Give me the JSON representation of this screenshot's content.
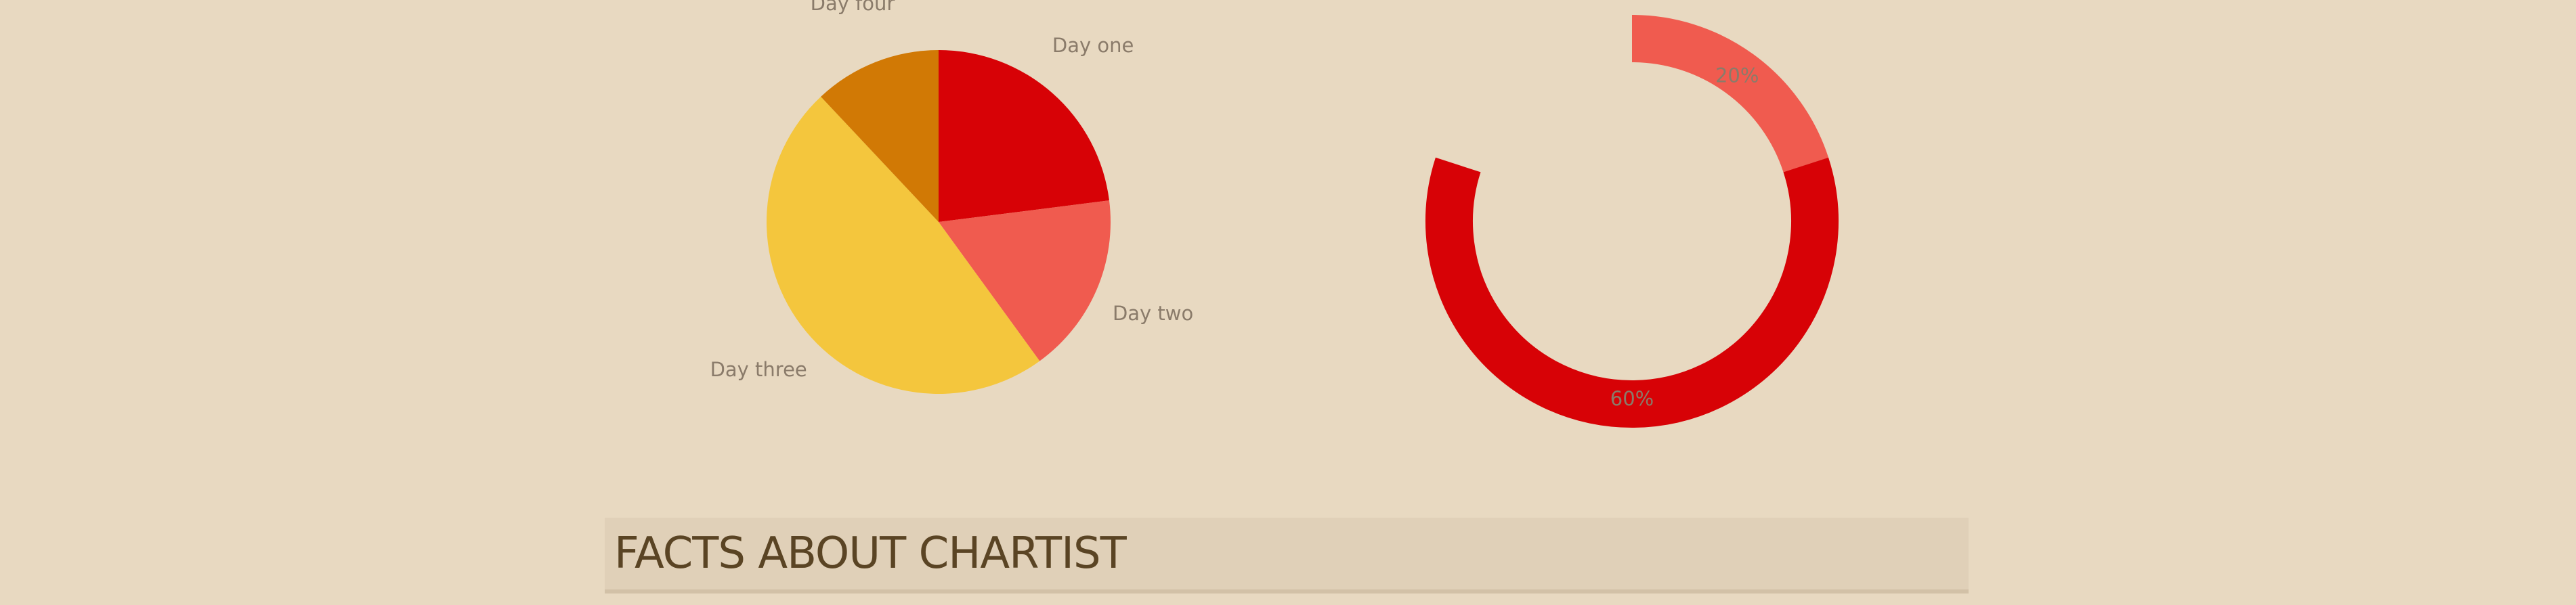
{
  "colors": {
    "background": "#e8d9c1",
    "banner_background": "#e0d0b8",
    "banner_text": "#5a4424",
    "label_text": "#8a7b6a",
    "series_a": "#d70206",
    "series_b": "#f05b4f",
    "series_c": "#f4c63d",
    "series_d": "#d17905"
  },
  "chart_data": [
    {
      "type": "pie",
      "categories": [
        "Day one",
        "Day two",
        "Day three",
        "Day four"
      ],
      "values": [
        23,
        17,
        48,
        12
      ],
      "colors": [
        "#d70206",
        "#f05b4f",
        "#f4c63d",
        "#d17905"
      ],
      "legend": "none"
    },
    {
      "type": "pie",
      "style": "donut",
      "values": [
        20,
        60
      ],
      "labels": [
        "20%",
        "60%"
      ],
      "total": 100,
      "colors": [
        "#f05b4f",
        "#d70206"
      ],
      "legend": "none"
    }
  ],
  "banner": {
    "title": "FACTS ABOUT CHARTIST"
  }
}
